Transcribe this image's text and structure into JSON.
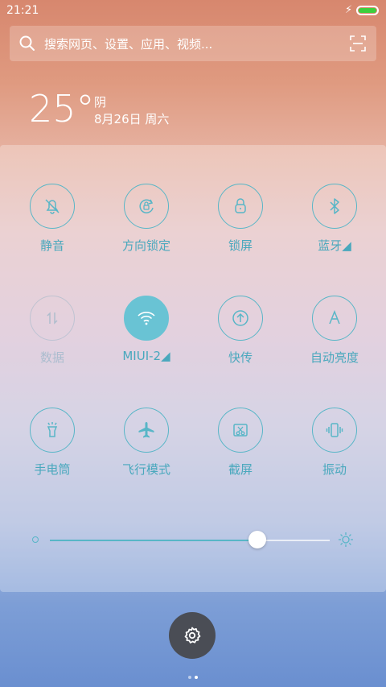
{
  "status": {
    "time": "21:21",
    "battery_color": "#3ccf3c"
  },
  "search": {
    "placeholder": "搜索网页、设置、应用、视频..."
  },
  "weather": {
    "temperature": "25°",
    "condition": "阴",
    "date": "8月26日 周六"
  },
  "toggles": [
    {
      "label": "静音",
      "icon": "mute-bell-icon",
      "state": "off"
    },
    {
      "label": "方向锁定",
      "icon": "rotation-lock-icon",
      "state": "off"
    },
    {
      "label": "锁屏",
      "icon": "lock-icon",
      "state": "off"
    },
    {
      "label": "蓝牙◢",
      "icon": "bluetooth-icon",
      "state": "off"
    },
    {
      "label": "数据",
      "icon": "mobile-data-icon",
      "state": "disabled"
    },
    {
      "label": "MIUI-2◢",
      "icon": "wifi-icon",
      "state": "on"
    },
    {
      "label": "快传",
      "icon": "quick-transfer-icon",
      "state": "off"
    },
    {
      "label": "自动亮度",
      "icon": "auto-brightness-icon",
      "state": "off"
    },
    {
      "label": "手电筒",
      "icon": "flashlight-icon",
      "state": "off"
    },
    {
      "label": "飞行模式",
      "icon": "airplane-icon",
      "state": "off"
    },
    {
      "label": "截屏",
      "icon": "screenshot-icon",
      "state": "off"
    },
    {
      "label": "振动",
      "icon": "vibrate-icon",
      "state": "off"
    }
  ],
  "brightness": {
    "level": 0.74
  },
  "pager": {
    "pages": 2,
    "current": 2
  },
  "colors": {
    "accent": "#58b6c7",
    "active_fill": "#69c3d4"
  }
}
